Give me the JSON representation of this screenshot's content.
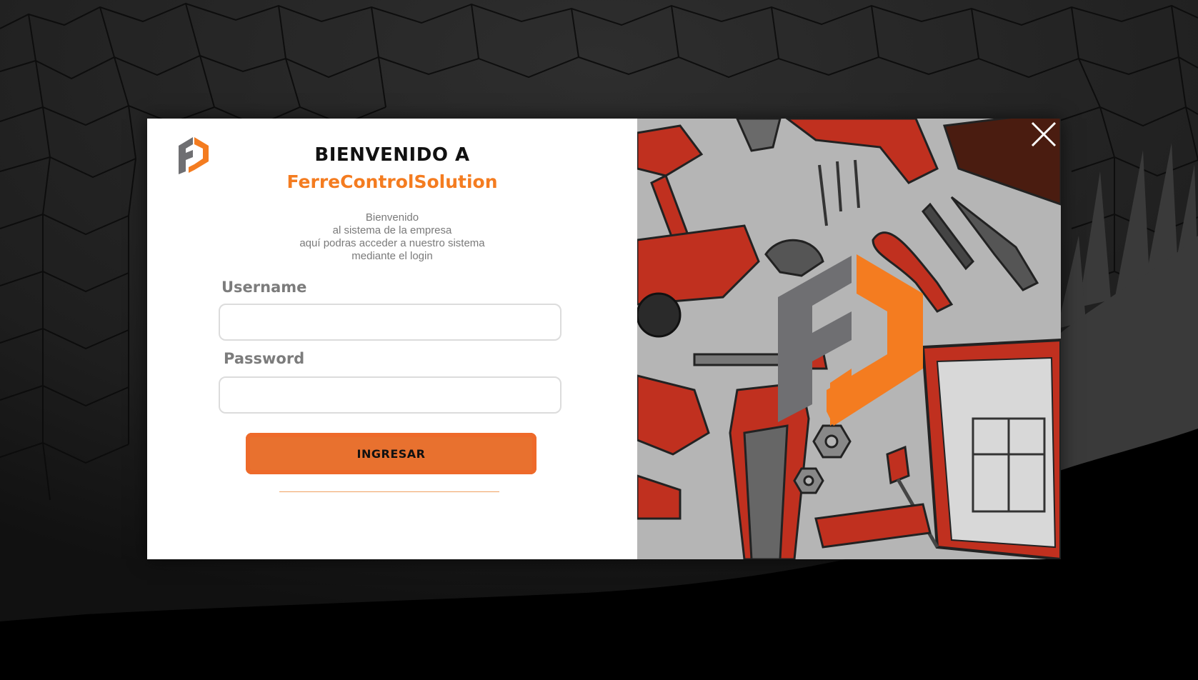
{
  "header": {
    "title": "BIENVENIDO A",
    "brand": "FerreControlSolution"
  },
  "welcome": {
    "lines": [
      "Bienvenido",
      "al sistema de la empresa",
      "aquí podras acceder a nuestro sistema",
      "mediante el login"
    ]
  },
  "form": {
    "username_label": "Username",
    "username_value": "",
    "password_label": "Password",
    "password_value": "",
    "submit_label": "INGRESAR"
  },
  "icons": {
    "logo": "ferrecontrol-logo",
    "close": "close-icon"
  },
  "colors": {
    "accent": "#f47c20",
    "button": "#e8712f",
    "logo_gray": "#6f6f72",
    "tool_red": "#c0301f",
    "illustration_bg": "#b5b5b5"
  }
}
